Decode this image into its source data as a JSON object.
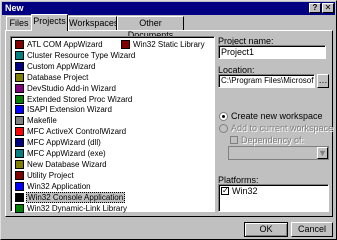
{
  "window": {
    "title": "New"
  },
  "tabs": [
    {
      "label": "Files",
      "active": false
    },
    {
      "label": "Projects",
      "active": true
    },
    {
      "label": "Workspaces",
      "active": false
    },
    {
      "label": "Other Documents",
      "active": false
    }
  ],
  "project_types_col1": [
    {
      "label": "ATL COM AppWizard",
      "icon": "atl-icon"
    },
    {
      "label": "Cluster Resource Type Wizard",
      "icon": "cluster-icon"
    },
    {
      "label": "Custom AppWizard",
      "icon": "custom-wizard-icon"
    },
    {
      "label": "Database Project",
      "icon": "database-icon"
    },
    {
      "label": "DevStudio Add-in Wizard",
      "icon": "addin-icon"
    },
    {
      "label": "Extended Stored Proc Wizard",
      "icon": "stored-proc-icon"
    },
    {
      "label": "ISAPI Extension Wizard",
      "icon": "isapi-icon"
    },
    {
      "label": "Makefile",
      "icon": "makefile-icon"
    },
    {
      "label": "MFC ActiveX ControlWizard",
      "icon": "activex-icon"
    },
    {
      "label": "MFC AppWizard (dll)",
      "icon": "mfc-dll-icon"
    },
    {
      "label": "MFC AppWizard (exe)",
      "icon": "mfc-exe-icon"
    },
    {
      "label": "New Database Wizard",
      "icon": "new-db-icon"
    },
    {
      "label": "Utility Project",
      "icon": "utility-icon"
    },
    {
      "label": "Win32 Application",
      "icon": "win32-app-icon"
    },
    {
      "label": "Win32 Console Application",
      "icon": "console-icon",
      "selected": true
    },
    {
      "label": "Win32 Dynamic-Link Library",
      "icon": "dll-icon"
    }
  ],
  "project_types_col2": [
    {
      "label": "Win32 Static Library",
      "icon": "static-lib-icon"
    }
  ],
  "fields": {
    "project_name_label": "Project name:",
    "project_name_value": "Project1",
    "location_label": "Location:",
    "location_value": "C:\\Program Files\\Microsoft Visua"
  },
  "workspace": {
    "create_new": "Create new workspace",
    "add_current": "Add to current workspace",
    "dependency": "Dependency of:"
  },
  "platforms": {
    "label": "Platforms:",
    "items": [
      {
        "label": "Win32",
        "checked": true
      }
    ]
  },
  "buttons": {
    "ok": "OK",
    "cancel": "Cancel"
  }
}
